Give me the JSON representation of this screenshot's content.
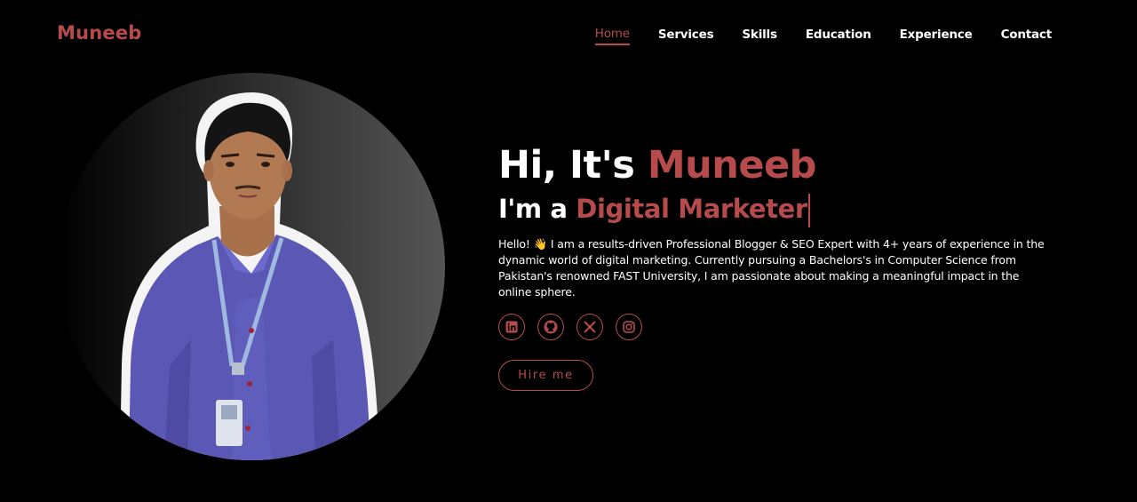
{
  "header": {
    "logo": "Muneeb",
    "nav": [
      {
        "label": "Home",
        "active": true
      },
      {
        "label": "Services"
      },
      {
        "label": "Skills"
      },
      {
        "label": "Education"
      },
      {
        "label": "Experience"
      },
      {
        "label": "Contact"
      }
    ]
  },
  "hero": {
    "greeting_prefix": "Hi, It's",
    "name": "Muneeb",
    "role_prefix": "I'm a",
    "role": "Digital Marketer",
    "bio": "Hello! 👋 I am a results-driven Professional Blogger & SEO Expert with 4+ years of experience in the dynamic world of digital marketing. Currently pursuing a Bachelors's in Computer Science from Pakistan's renowned FAST University, I am passionate about making a meaningful impact in the online sphere.",
    "socials": [
      {
        "icon": "linkedin-icon"
      },
      {
        "icon": "github-icon"
      },
      {
        "icon": "x-twitter-icon"
      },
      {
        "icon": "instagram-icon"
      }
    ],
    "hire_label": "Hire me"
  },
  "colors": {
    "accent": "#b74b4b",
    "background": "#000000",
    "text": "#ffffff"
  }
}
